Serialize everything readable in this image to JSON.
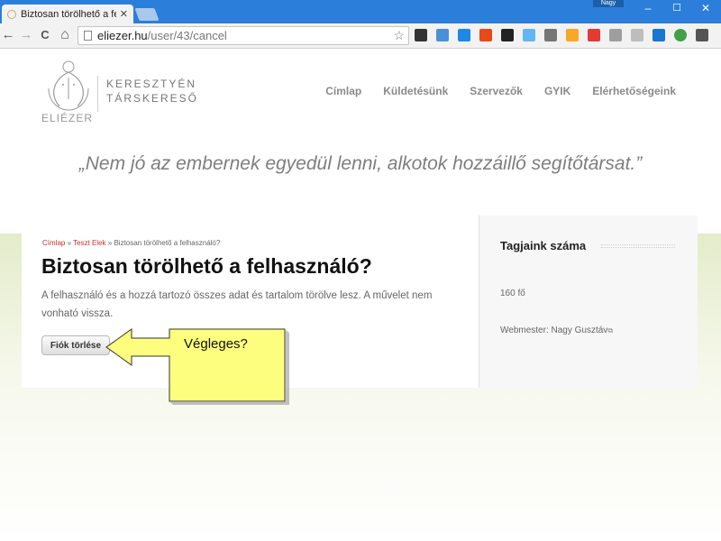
{
  "browser": {
    "tab_title": "Biztosan törölhető a felha",
    "tab_close": "✕",
    "profile_name": "Nagy",
    "url_host": "eliezer.hu",
    "url_path": "/user/43/cancel",
    "window_controls": {
      "minimize": "–",
      "maximize": "☐",
      "close": "✕"
    },
    "nav_icons": {
      "back": "←",
      "forward": "→",
      "reload": "C",
      "home": "⌂",
      "star": "☆"
    },
    "extension_colors": [
      "#333333",
      "#4a90d9",
      "#1e88e5",
      "#e64a19",
      "#222222",
      "#64b5f6",
      "#757575",
      "#f9a825",
      "#e53935",
      "#9e9e9e",
      "#bdbdbd",
      "#1976d2",
      "#43a047",
      "#555555"
    ],
    "accent_color": "#2b7fdb"
  },
  "site": {
    "logo_line1": "KERESZTYÉN",
    "logo_line2": "TÁRSKERESŐ",
    "logo_word": "ELIÉZER",
    "nav": [
      "Címlap",
      "Küldetésünk",
      "Szervezők",
      "GYIK",
      "Elérhetőségeink"
    ],
    "quote": "„Nem jó az embernek egyedül lenni, alkotok hozzáillő segítőtársat.”"
  },
  "main": {
    "breadcrumb": {
      "home": "Címlap",
      "sep1": " » ",
      "user": "Teszt Elek",
      "sep2": " » ",
      "current": "Biztosan törölhető a felhasználó?"
    },
    "title": "Biztosan törölhető a felhasználó?",
    "body": "A felhasználó és a hozzá tartozó összes adat és tartalom törölve lesz. A művelet nem vonható vissza.",
    "delete_button": "Fiók törlése"
  },
  "sidebar": {
    "title": "Tagjaink száma",
    "count": "160 fő",
    "webmaster_label": "Webmester: ",
    "webmaster_name": "Nagy Gusztáv",
    "ext_icon": "⧉"
  },
  "annotation": {
    "text": "Végleges?",
    "color": "#fefe7e"
  }
}
